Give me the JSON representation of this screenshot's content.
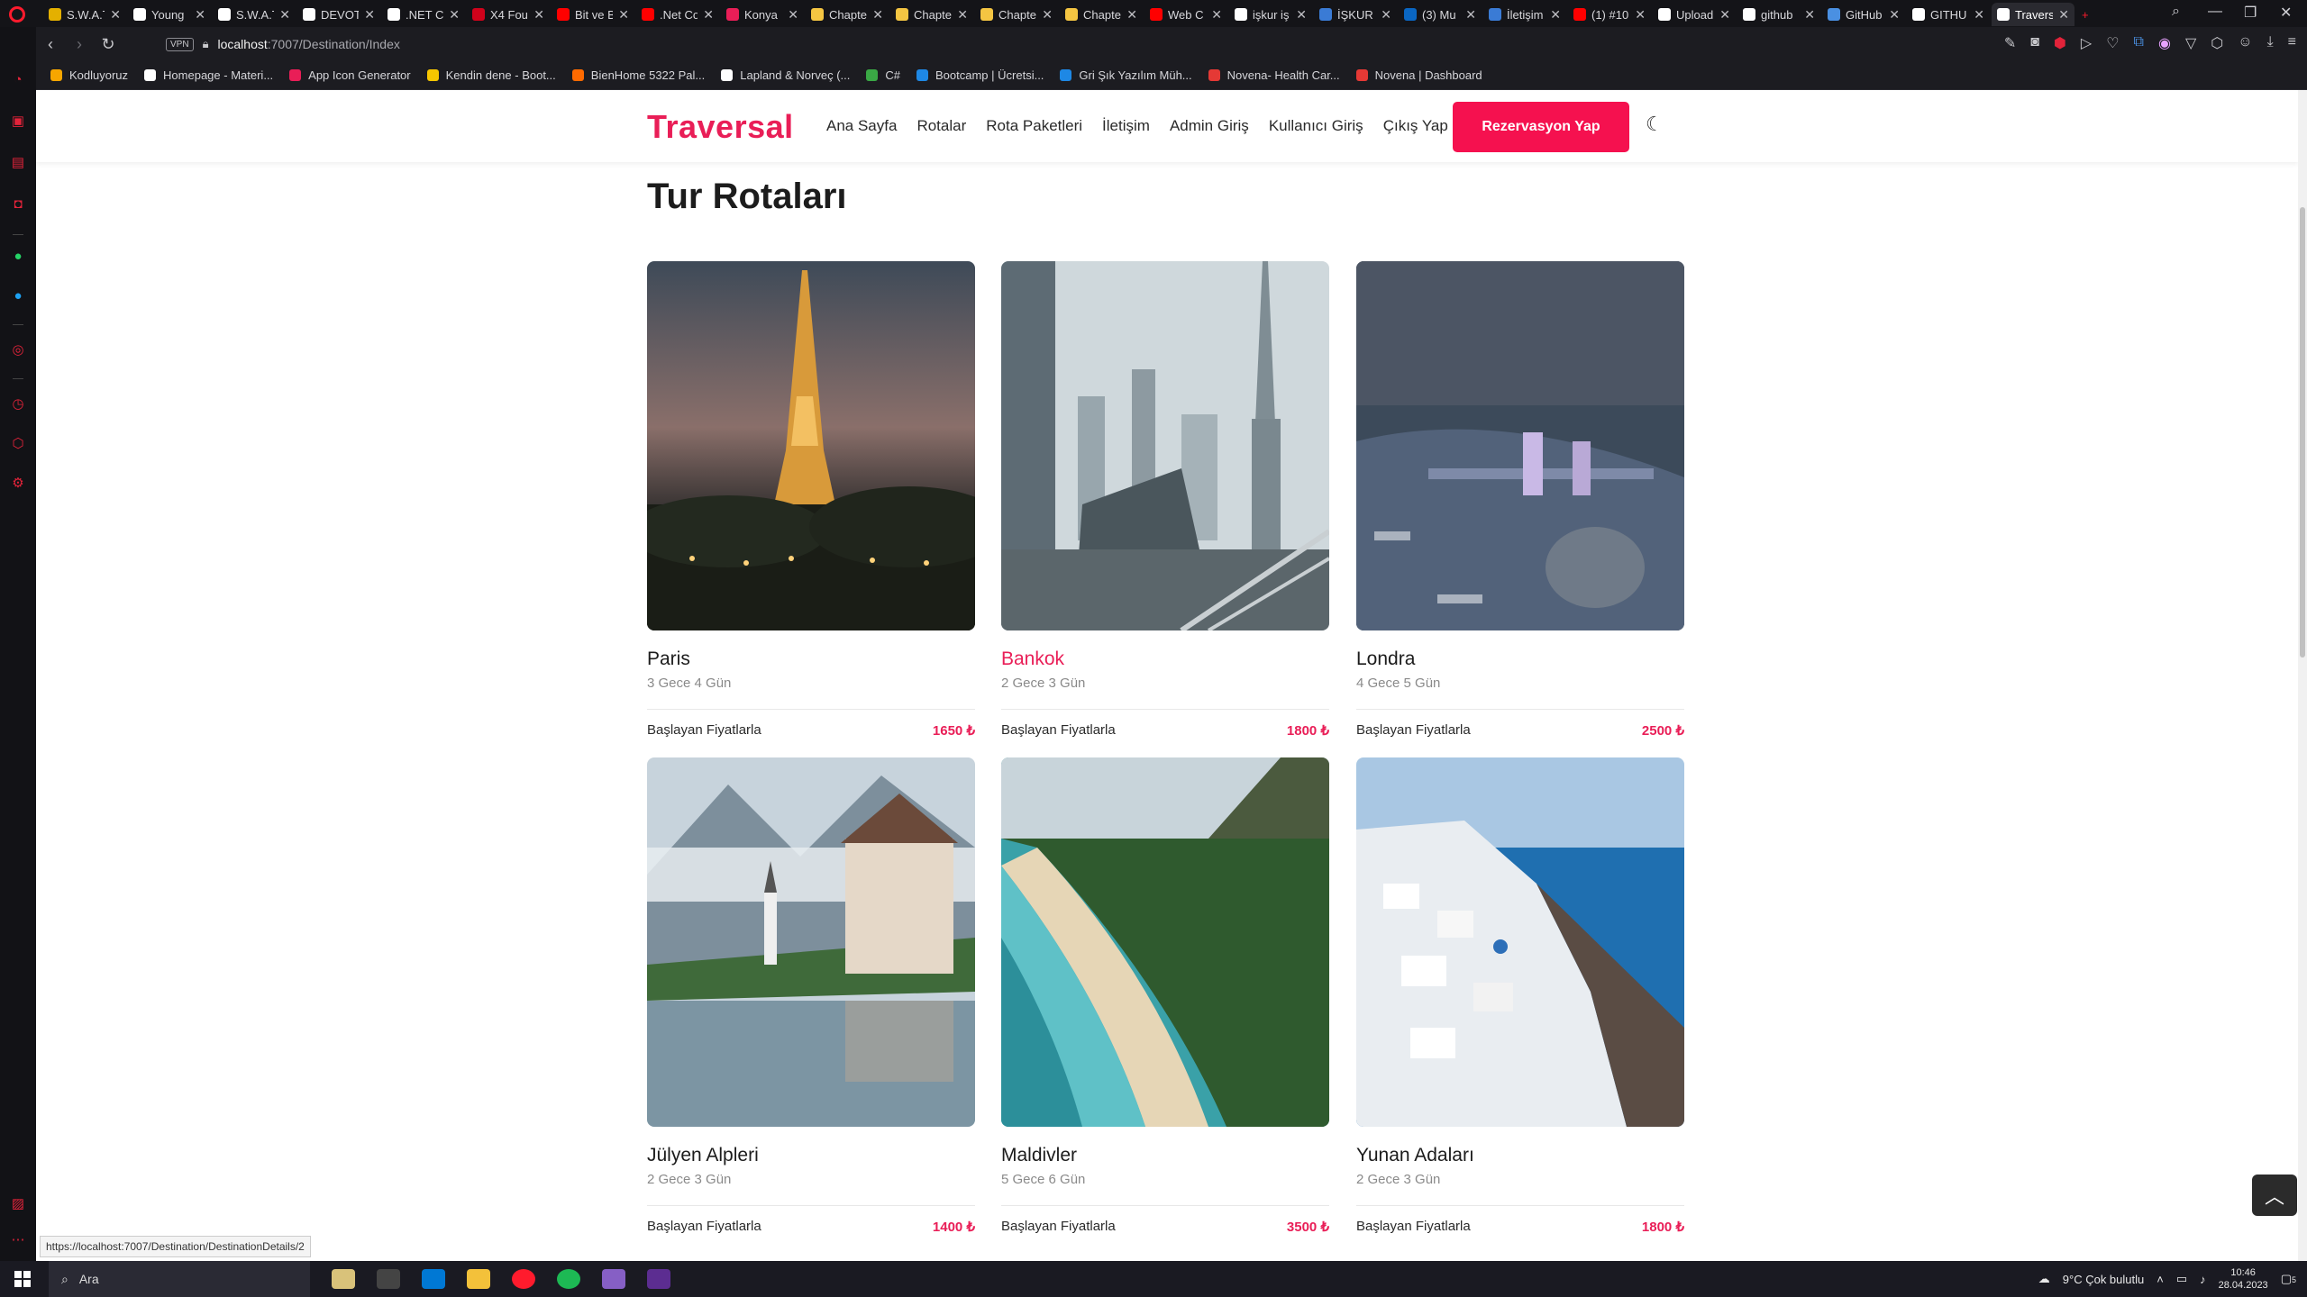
{
  "browser": {
    "tabs": [
      {
        "label": "S.W.A.T",
        "color": "#e4b000"
      },
      {
        "label": "Young",
        "color": "#ffffff"
      },
      {
        "label": "S.W.A.T",
        "color": "#ffffff"
      },
      {
        "label": "DEVOT",
        "color": "#ffffff"
      },
      {
        "label": ".NET C",
        "color": "#ffffff"
      },
      {
        "label": "X4 Fou",
        "color": "#d0021b"
      },
      {
        "label": "Bit ve B",
        "color": "#ff0000"
      },
      {
        "label": ".Net Co",
        "color": "#ff0000"
      },
      {
        "label": "Konya",
        "color": "#e91e57"
      },
      {
        "label": "Chapte",
        "color": "#f4c542"
      },
      {
        "label": "Chapte",
        "color": "#f4c542"
      },
      {
        "label": "Chapte",
        "color": "#f4c542"
      },
      {
        "label": "Chapte",
        "color": "#f4c542"
      },
      {
        "label": "Web C",
        "color": "#ff0000"
      },
      {
        "label": "işkur iş",
        "color": "#ffffff"
      },
      {
        "label": "İŞKUR",
        "color": "#3a7bd5"
      },
      {
        "label": "(3) Mu",
        "color": "#0a66c2"
      },
      {
        "label": "İletişim",
        "color": "#3a7bd5"
      },
      {
        "label": "(1) #10",
        "color": "#ff0000"
      },
      {
        "label": "Upload",
        "color": "#ffffff"
      },
      {
        "label": "github",
        "color": "#ffffff"
      },
      {
        "label": "GitHub",
        "color": "#4a90e2"
      },
      {
        "label": "GITHU",
        "color": "#ffffff"
      },
      {
        "label": "Travers",
        "color": "#ffffff",
        "active": true
      }
    ],
    "address": {
      "vpn_label": "VPN",
      "host": "localhost",
      "path": ":7007/Destination/Index"
    },
    "bookmarks": [
      {
        "label": "Kodluyoruz",
        "color": "#f7a600"
      },
      {
        "label": "Homepage - Materi...",
        "color": "#ffffff"
      },
      {
        "label": "App Icon Generator",
        "color": "#e91e57"
      },
      {
        "label": "Kendin dene - Boot...",
        "color": "#f7c600"
      },
      {
        "label": "BienHome 5322 Pal...",
        "color": "#ff6a00"
      },
      {
        "label": "Lapland & Norveç (...",
        "color": "#ffffff"
      },
      {
        "label": "C#",
        "color": "#3aa845"
      },
      {
        "label": "Bootcamp | Ücretsi...",
        "color": "#1e88e5"
      },
      {
        "label": "Gri Şık Yazılım Müh...",
        "color": "#1e88e5"
      },
      {
        "label": "Novena- Health Car...",
        "color": "#e53935"
      },
      {
        "label": "Novena | Dashboard",
        "color": "#e53935"
      }
    ],
    "status_url": "https://localhost:7007/Destination/DestinationDetails/2"
  },
  "site": {
    "logo": "Traversal",
    "nav": [
      "Ana Sayfa",
      "Rotalar",
      "Rota Paketleri",
      "İletişim",
      "Admin Giriş",
      "Kullanıcı Giriş",
      "Çıkış Yap"
    ],
    "cta_label": "Rezervasyon Yap",
    "section_title": "Tur Rotaları",
    "price_prefix": "Başlayan Fiyatlarla",
    "destinations": [
      {
        "name": "Paris",
        "duration": "3 Gece 4 Gün",
        "price": "1650 ₺",
        "image": "paris-eiffel-night"
      },
      {
        "name": "Bankok",
        "duration": "2 Gece 3 Gün",
        "price": "1800 ₺",
        "image": "city-skyline",
        "highlight": true
      },
      {
        "name": "Londra",
        "duration": "4 Gece 5 Gün",
        "price": "2500 ₺",
        "image": "tower-bridge-aerial"
      },
      {
        "name": "Jülyen Alpleri",
        "duration": "2 Gece 3 Gün",
        "price": "1400 ₺",
        "image": "alpine-lake-village"
      },
      {
        "name": "Maldivler",
        "duration": "5 Gece 6 Gün",
        "price": "3500 ₺",
        "image": "tropical-beach-aerial"
      },
      {
        "name": "Yunan Adaları",
        "duration": "2 Gece 3 Gün",
        "price": "1800 ₺",
        "image": "greek-island-village"
      }
    ]
  },
  "taskbar": {
    "search_placeholder": "Ara",
    "weather": "9°C  Çok bulutlu",
    "time": "10:46",
    "date": "28.04.2023",
    "notifications": "5"
  },
  "colors": {
    "brand": "#e91e57",
    "cta": "#f5114f",
    "browser_accent": "#ff1b2d"
  }
}
